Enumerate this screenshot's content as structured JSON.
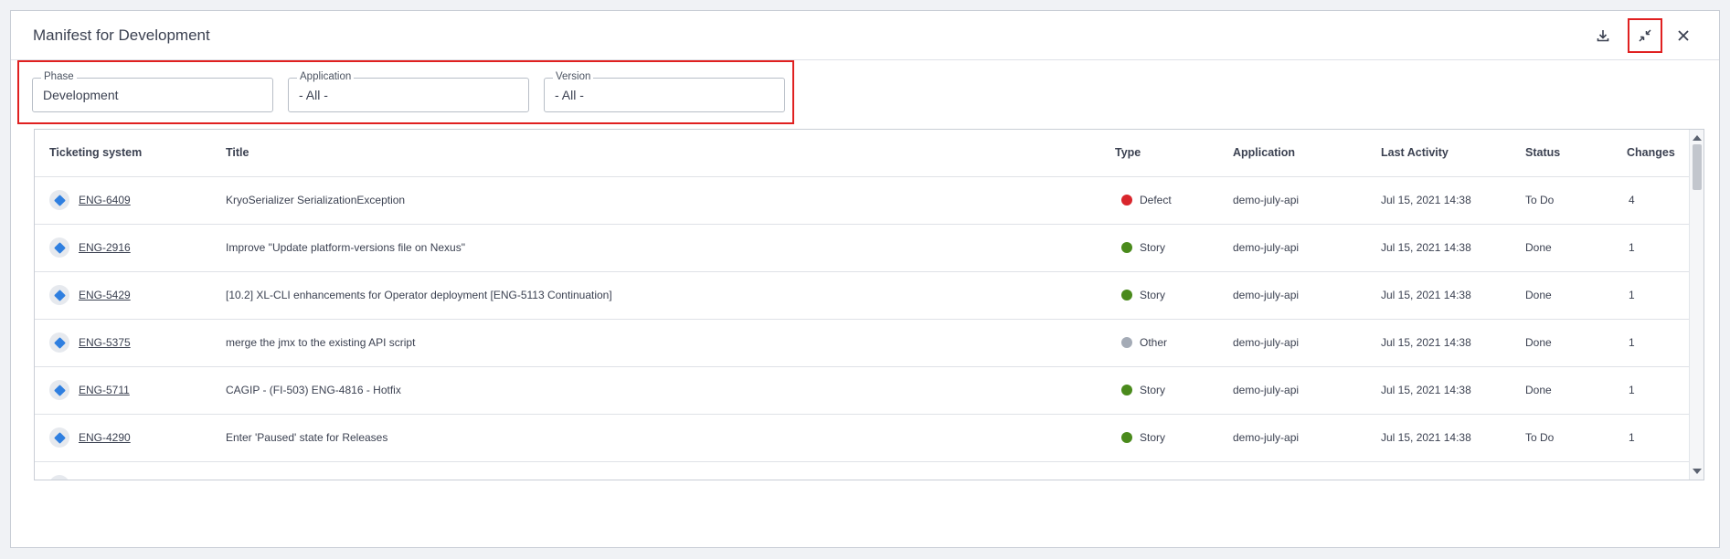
{
  "dialog": {
    "title": "Manifest for Development",
    "icons": {
      "download": "download-icon",
      "collapse": "collapse-icon",
      "close": "close-icon"
    }
  },
  "filters": {
    "phase": {
      "label": "Phase",
      "value": "Development"
    },
    "application": {
      "label": "Application",
      "value": "- All -"
    },
    "version": {
      "label": "Version",
      "value": "- All -"
    }
  },
  "table": {
    "columns": [
      "Ticketing system",
      "Title",
      "Type",
      "Application",
      "Last Activity",
      "Status",
      "Changes"
    ],
    "rows": [
      {
        "ticket": "ENG-6409",
        "title": "KryoSerializer SerializationException",
        "type": "Defect",
        "type_color": "#d9262c",
        "application": "demo-july-api",
        "last_activity": "Jul 15, 2021 14:38",
        "status": "To Do",
        "changes": "4"
      },
      {
        "ticket": "ENG-2916",
        "title": "Improve \"Update platform-versions file on Nexus\"",
        "type": "Story",
        "type_color": "#4a8a1c",
        "application": "demo-july-api",
        "last_activity": "Jul 15, 2021 14:38",
        "status": "Done",
        "changes": "1"
      },
      {
        "ticket": "ENG-5429",
        "title": "[10.2] XL-CLI enhancements for Operator deployment [ENG-5113 Continuation]",
        "type": "Story",
        "type_color": "#4a8a1c",
        "application": "demo-july-api",
        "last_activity": "Jul 15, 2021 14:38",
        "status": "Done",
        "changes": "1"
      },
      {
        "ticket": "ENG-5375",
        "title": "merge the jmx to the existing API script",
        "type": "Other",
        "type_color": "#a4abb6",
        "application": "demo-july-api",
        "last_activity": "Jul 15, 2021 14:38",
        "status": "Done",
        "changes": "1"
      },
      {
        "ticket": "ENG-5711",
        "title": "CAGIP - (FI-503) ENG-4816 - Hotfix",
        "type": "Story",
        "type_color": "#4a8a1c",
        "application": "demo-july-api",
        "last_activity": "Jul 15, 2021 14:38",
        "status": "Done",
        "changes": "1"
      },
      {
        "ticket": "ENG-4290",
        "title": "Enter 'Paused' state for Releases",
        "type": "Story",
        "type_color": "#4a8a1c",
        "application": "demo-july-api",
        "last_activity": "Jul 15, 2021 14:38",
        "status": "To Do",
        "changes": "1"
      }
    ]
  }
}
